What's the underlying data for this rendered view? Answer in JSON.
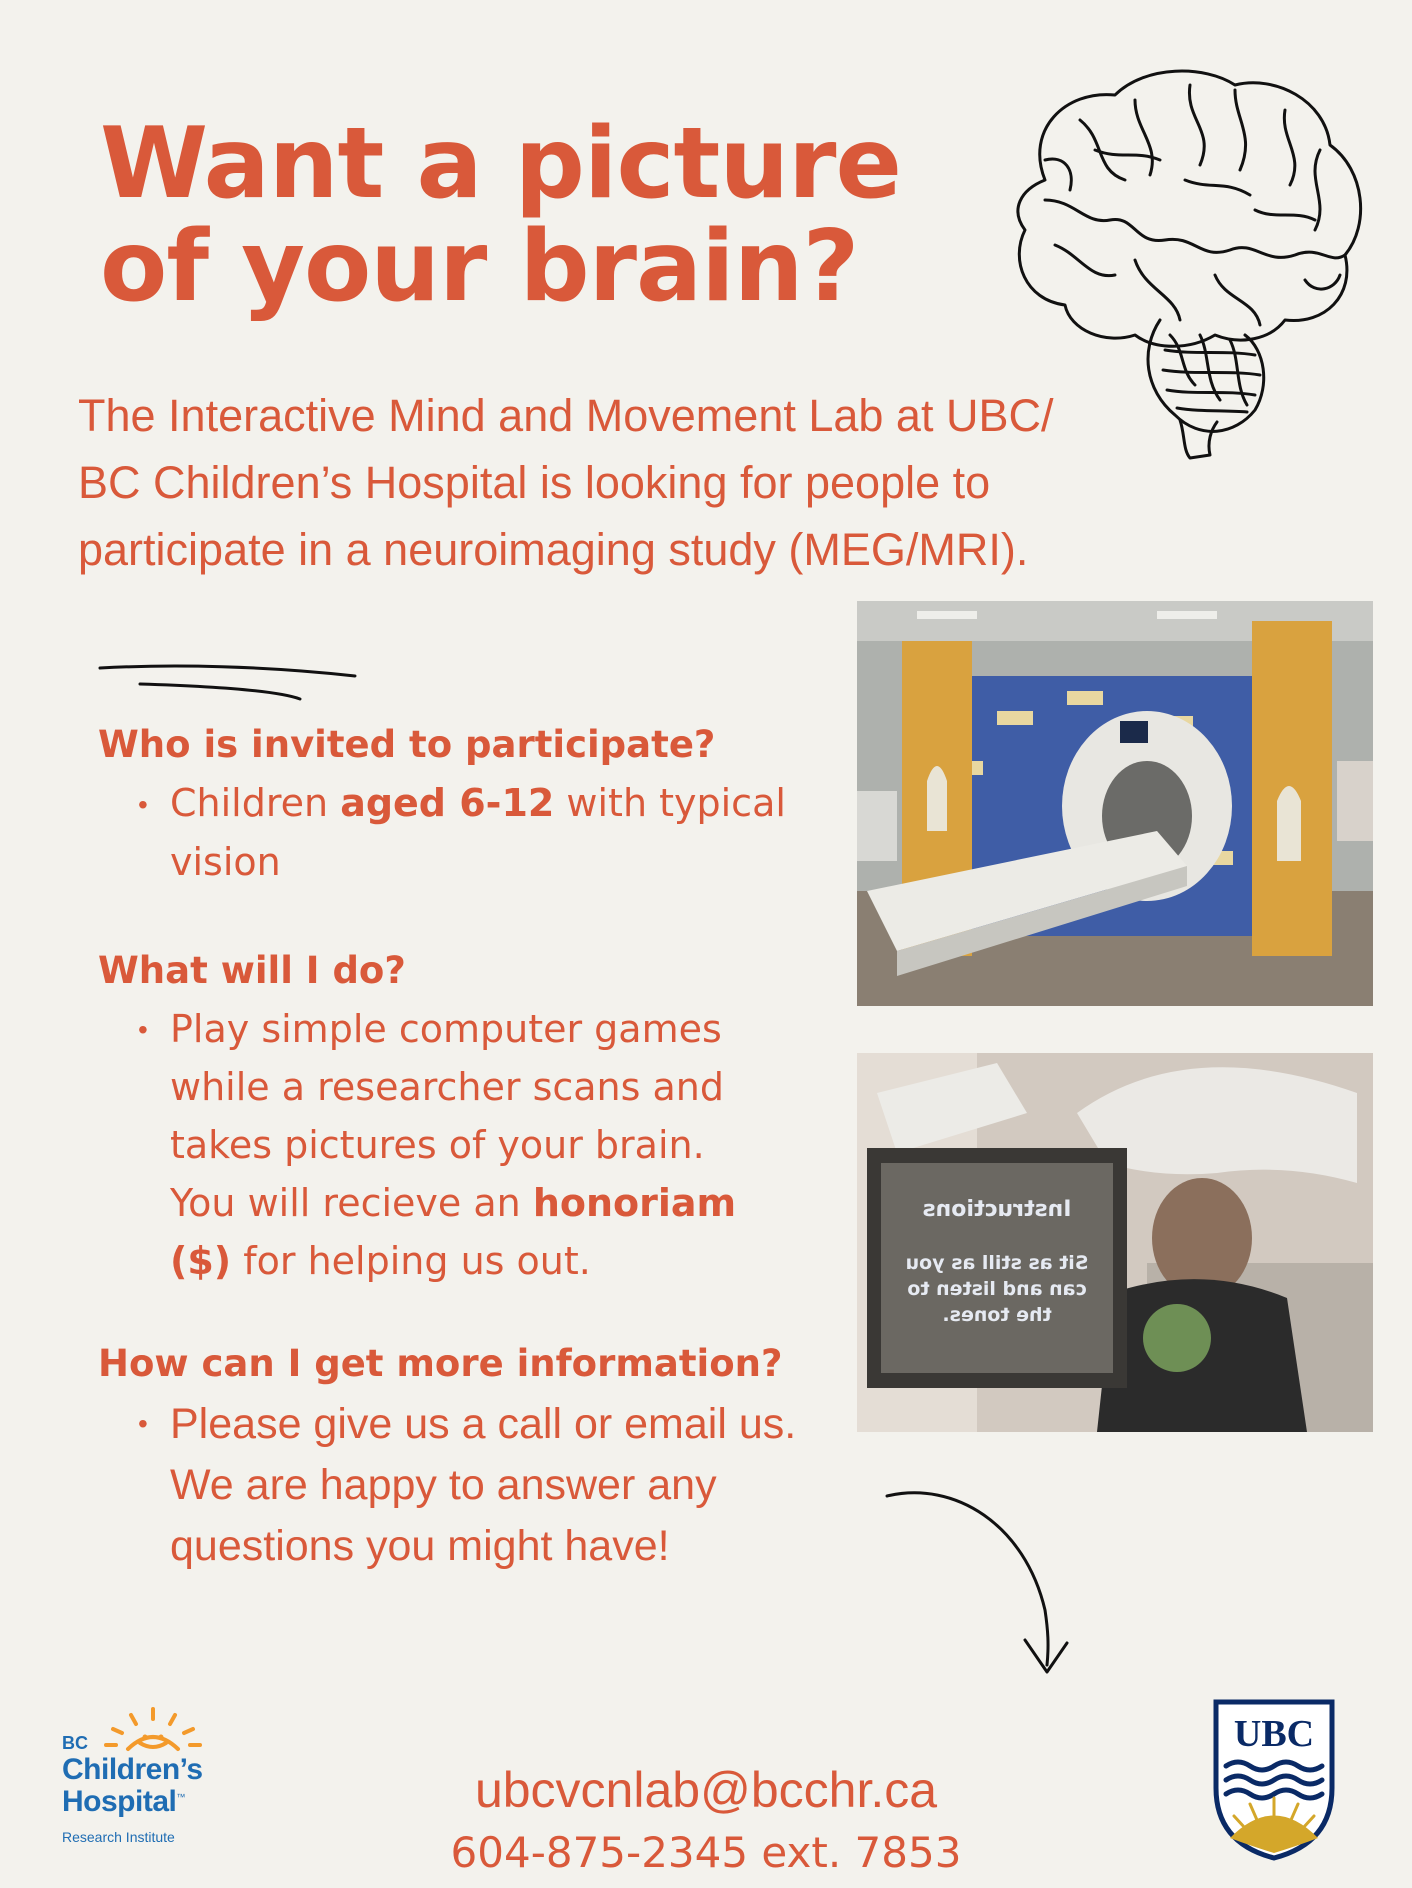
{
  "title": {
    "line1": "Want a picture",
    "line2": "of your brain?"
  },
  "intro": {
    "line1": "The Interactive Mind and Movement Lab at UBC/",
    "line2": "BC Children’s Hospital is looking for people to",
    "line3": "participate in a neuroimaging study (MEG/MRI)."
  },
  "sections": {
    "who": {
      "heading": "Who is invited to participate?",
      "line1_pre": "Children ",
      "line1_bold": "aged 6-12",
      "line1_post": " with typical",
      "line2": "vision"
    },
    "what": {
      "heading": "What will I do?",
      "line1": "Play simple computer games",
      "line2": "while a researcher scans and",
      "line3": "takes pictures of your brain.",
      "line4_pre": "You will recieve an ",
      "line4_bold": "honoriam",
      "line5_bold": "($)",
      "line5_post": " for helping us out."
    },
    "how": {
      "heading": "How can I get more information?",
      "line1": "Please give us a call or email us.",
      "line2": "We are happy to answer any",
      "line3": "questions you might have!"
    }
  },
  "photo2_screen": {
    "title": "Instructions",
    "line1": "Sit as still as you",
    "line2": "can and listen to",
    "line3": "the tones."
  },
  "contact": {
    "email": "ubcvcnlab@bcchr.ca",
    "phone": "604-875-2345 ext. 7853"
  },
  "logos": {
    "bcch": {
      "bc": "BC",
      "line1": "Children’s",
      "line2": "Hospital",
      "tm": "™",
      "line3": "Research Institute"
    },
    "ubc": {
      "text": "UBC"
    }
  },
  "colors": {
    "accent": "#d9593a",
    "background": "#f3f2ed",
    "bcch_blue": "#1f6db3",
    "bcch_orange": "#f39a2b",
    "ubc_navy": "#0a2a66",
    "ubc_gold": "#d4a72a"
  }
}
